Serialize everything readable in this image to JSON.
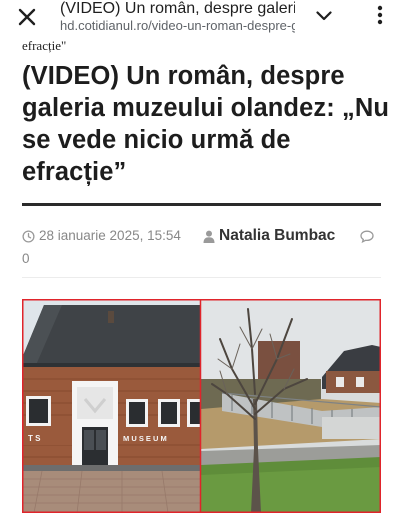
{
  "browser": {
    "title": "(VIDEO) Un român, despre galeria muzeului olandez",
    "url": "hd.cotidianul.ro/video-un-roman-despre-galeria-muzeului-olandez",
    "close_icon": "close-icon",
    "expand_icon": "chevron-down-icon",
    "menu_icon": "more-vertical-icon"
  },
  "article": {
    "prev_title_tail": "efracție\"",
    "headline": "(VIDEO) Un român, despre galeria muzeului olandez: „Nu se vede nicio urmă de efracție”",
    "date": "28 ianuarie 2025, 15:54",
    "author": "Natalia Bumbac",
    "comment_count": "0",
    "image": {
      "left_sign_left": "T S",
      "left_sign_right": "M U S E U M",
      "border_color": "#e0242b"
    }
  },
  "colors": {
    "meta_gray": "#888888",
    "accent_red": "#e0242b"
  }
}
